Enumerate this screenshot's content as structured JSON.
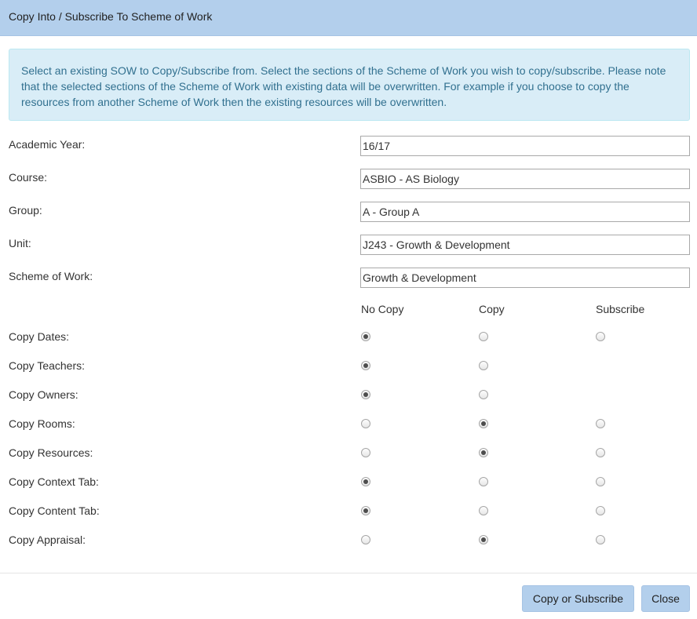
{
  "dialog": {
    "title": "Copy Into / Subscribe To Scheme of Work",
    "info": "Select an existing SOW to Copy/Subscribe from. Select the sections of the Scheme of Work you wish to copy/subscribe. Please note that the selected sections of the Scheme of Work with existing data will be overwritten. For example if you choose to copy the resources from another Scheme of Work then the existing resources will be overwritten."
  },
  "fields": [
    {
      "label": "Academic Year:",
      "value": "16/17"
    },
    {
      "label": "Course:",
      "value": "ASBIO - AS Biology"
    },
    {
      "label": "Group:",
      "value": "A - Group A"
    },
    {
      "label": "Unit:",
      "value": "J243 - Growth & Development"
    },
    {
      "label": "Scheme of Work:",
      "value": "Growth & Development"
    }
  ],
  "options_header": [
    "No Copy",
    "Copy",
    "Subscribe"
  ],
  "options": [
    {
      "label": "Copy Dates:",
      "choices": [
        "No Copy",
        "Copy",
        "Subscribe"
      ],
      "selected": "No Copy"
    },
    {
      "label": "Copy Teachers:",
      "choices": [
        "No Copy",
        "Copy"
      ],
      "selected": "No Copy"
    },
    {
      "label": "Copy Owners:",
      "choices": [
        "No Copy",
        "Copy"
      ],
      "selected": "No Copy"
    },
    {
      "label": "Copy Rooms:",
      "choices": [
        "No Copy",
        "Copy",
        "Subscribe"
      ],
      "selected": "Copy"
    },
    {
      "label": "Copy Resources:",
      "choices": [
        "No Copy",
        "Copy",
        "Subscribe"
      ],
      "selected": "Copy"
    },
    {
      "label": "Copy Context Tab:",
      "choices": [
        "No Copy",
        "Copy",
        "Subscribe"
      ],
      "selected": "No Copy"
    },
    {
      "label": "Copy Content Tab:",
      "choices": [
        "No Copy",
        "Copy",
        "Subscribe"
      ],
      "selected": "No Copy"
    },
    {
      "label": "Copy Appraisal:",
      "choices": [
        "No Copy",
        "Copy",
        "Subscribe"
      ],
      "selected": "Copy"
    }
  ],
  "buttons": {
    "submit": "Copy or Subscribe",
    "close": "Close"
  },
  "colors": {
    "header_bg": "#b3cfec",
    "info_bg": "#d9edf7",
    "info_text": "#31708f",
    "button_bg": "#b3cfec"
  }
}
